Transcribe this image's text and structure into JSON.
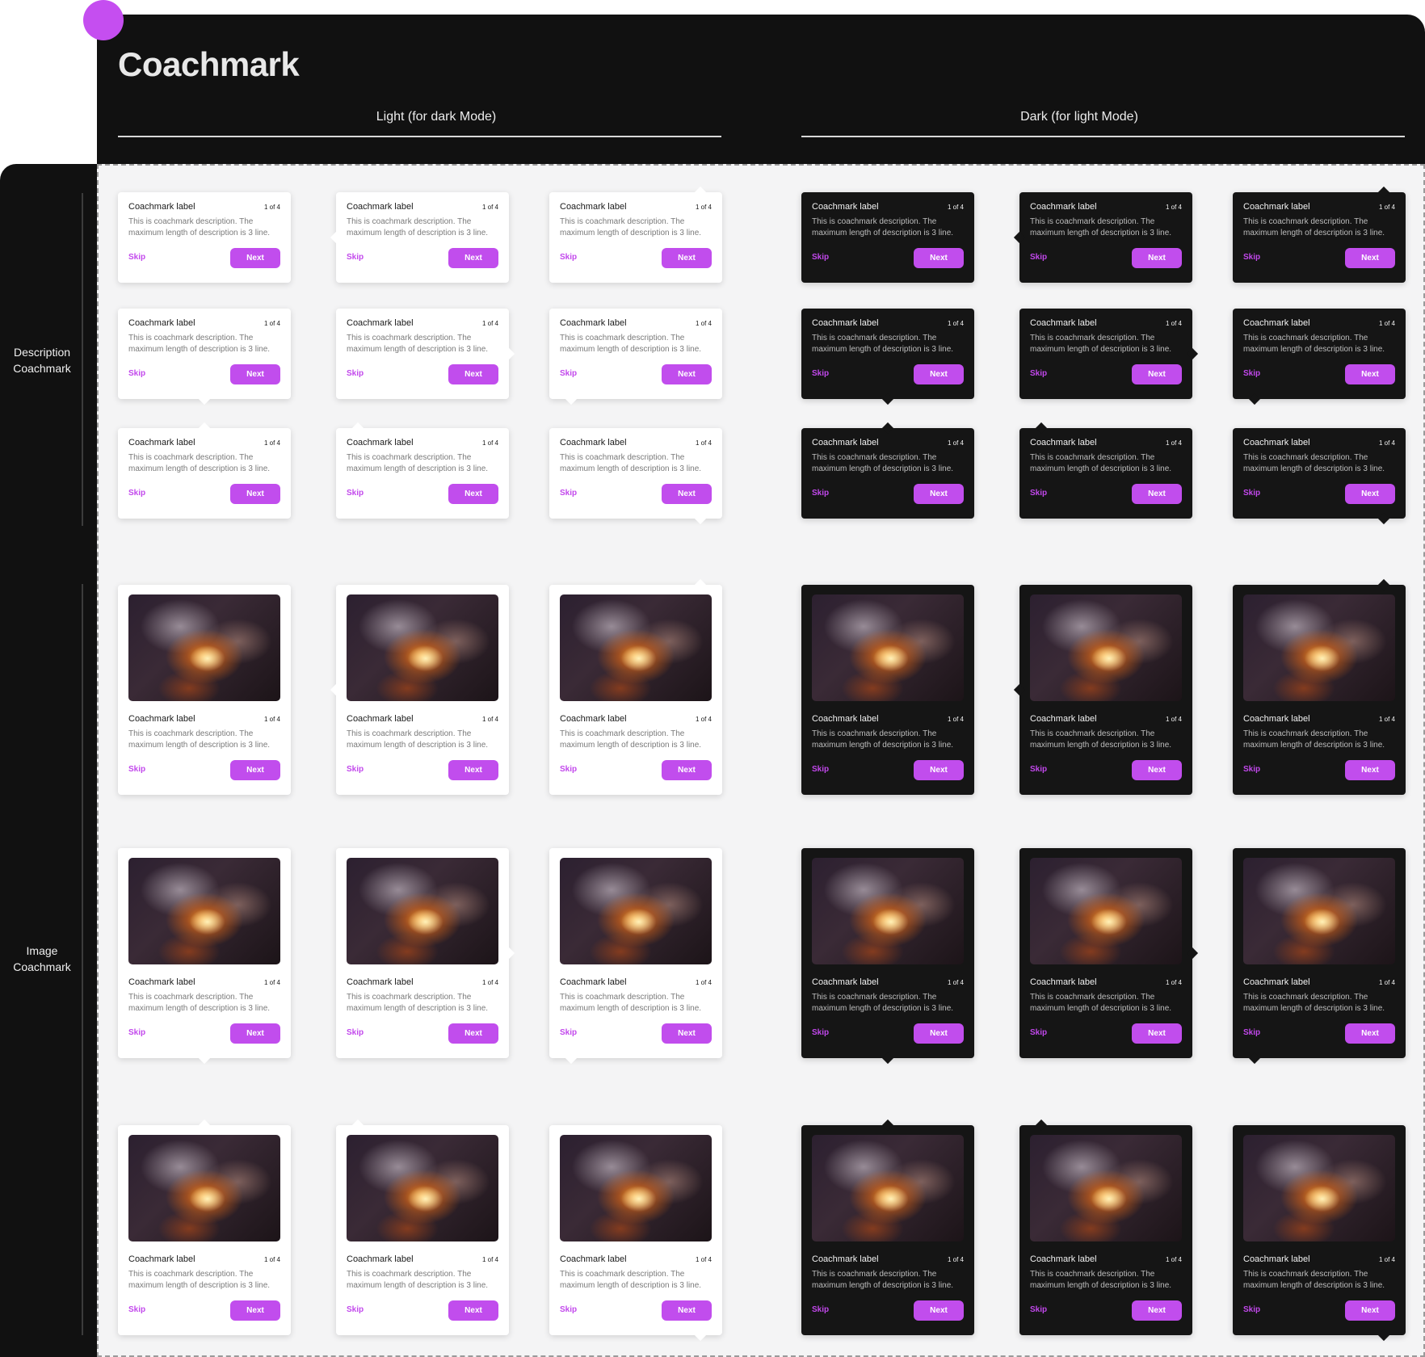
{
  "page": {
    "title": "Coachmark",
    "columns": [
      "Light (for dark Mode)",
      "Dark (for light Mode)"
    ],
    "sections": [
      {
        "line1": "Description",
        "line2": "Coachmark"
      },
      {
        "line1": "Image",
        "line2": "Coachmark"
      }
    ],
    "accent_color": "#c14ded",
    "dark_surface": "#151515"
  },
  "card": {
    "label": "Coachmark label",
    "counter": "1 of 4",
    "description": "This is coachmark description. The maximum length of description is 3 line.",
    "skip": "Skip",
    "next": "Next"
  }
}
